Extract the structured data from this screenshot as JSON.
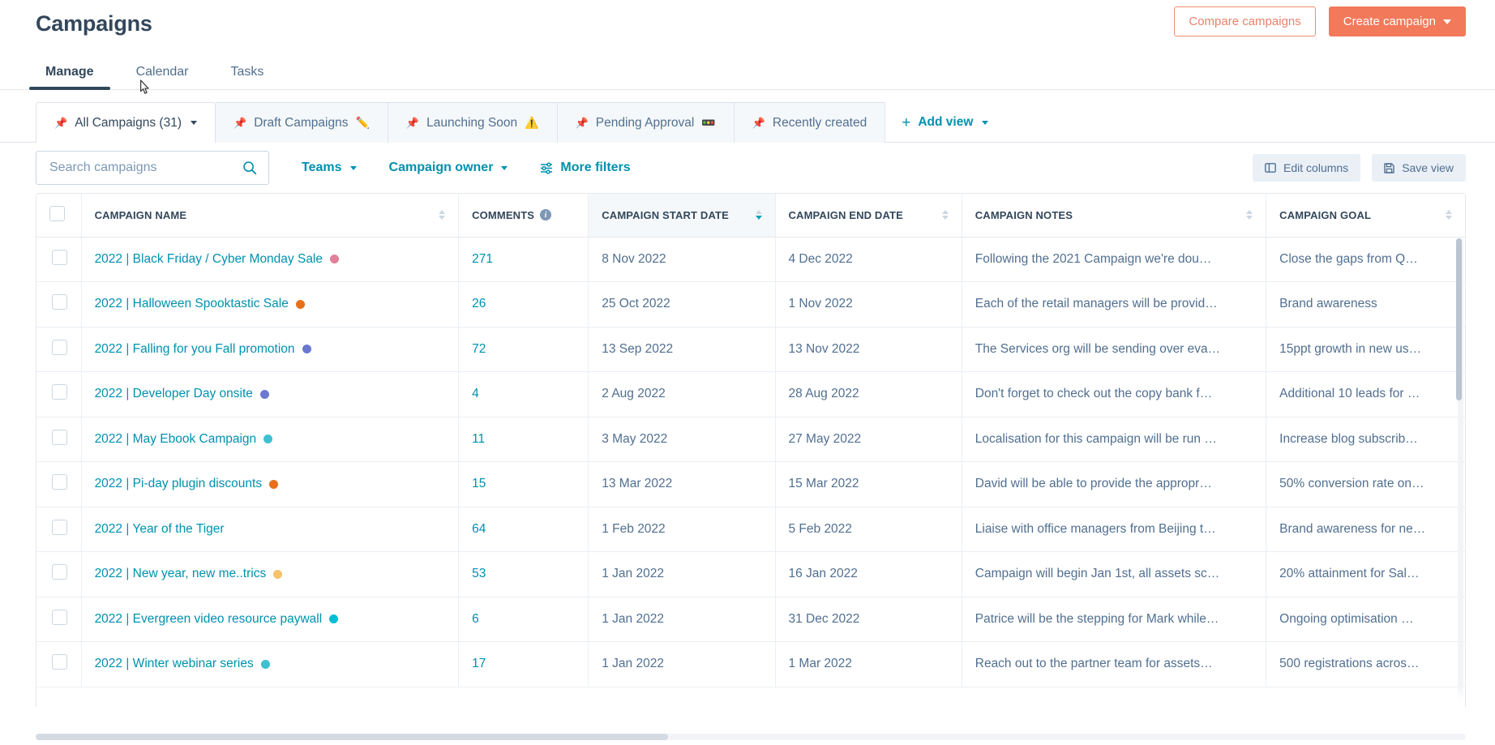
{
  "header": {
    "title": "Campaigns",
    "compare_label": "Compare campaigns",
    "create_label": "Create campaign"
  },
  "top_tabs": [
    {
      "label": "Manage",
      "active": true
    },
    {
      "label": "Calendar",
      "active": false
    },
    {
      "label": "Tasks",
      "active": false
    }
  ],
  "view_tabs": [
    {
      "label": "All Campaigns (31)",
      "emoji": "",
      "active": true,
      "has_caret": true
    },
    {
      "label": "Draft Campaigns",
      "emoji": "✏️",
      "active": false,
      "has_caret": false
    },
    {
      "label": "Launching Soon",
      "emoji": "⚠️",
      "active": false,
      "has_caret": false
    },
    {
      "label": "Pending Approval",
      "emoji": "🚥",
      "active": false,
      "has_caret": false
    },
    {
      "label": "Recently created",
      "emoji": "",
      "active": false,
      "has_caret": false
    }
  ],
  "add_view": {
    "label": "Add view"
  },
  "filters": {
    "search_placeholder": "Search campaigns",
    "search_value": "",
    "search_icon": "search-icon",
    "teams_label": "Teams",
    "owner_label": "Campaign owner",
    "more_filters_label": "More filters",
    "edit_columns_label": "Edit columns",
    "save_view_label": "Save view"
  },
  "table": {
    "columns": [
      {
        "label": "CAMPAIGN NAME",
        "sortable": true,
        "sorted": false,
        "info": false
      },
      {
        "label": "COMMENTS",
        "sortable": false,
        "sorted": false,
        "info": true
      },
      {
        "label": "CAMPAIGN START DATE",
        "sortable": true,
        "sorted": true,
        "info": false
      },
      {
        "label": "CAMPAIGN END DATE",
        "sortable": true,
        "sorted": false,
        "info": false
      },
      {
        "label": "CAMPAIGN NOTES",
        "sortable": true,
        "sorted": false,
        "info": false
      },
      {
        "label": "CAMPAIGN GOAL",
        "sortable": true,
        "sorted": false,
        "info": false
      }
    ],
    "rows": [
      {
        "name": "2022 | Black Friday / Cyber Monday Sale",
        "dot": "#e08099",
        "comments": "271",
        "start": "8 Nov 2022",
        "end": "4 Dec 2022",
        "notes": "Following the 2021 Campaign we're dou…",
        "goal": "Close the gaps from Q…"
      },
      {
        "name": "2022 | Halloween Spooktastic Sale",
        "dot": "#e8701a",
        "comments": "26",
        "start": "25 Oct 2022",
        "end": "1 Nov 2022",
        "notes": "Each of the retail managers will be provid…",
        "goal": "Brand awareness"
      },
      {
        "name": "2022 | Falling for you Fall promotion",
        "dot": "#6a78d1",
        "comments": "72",
        "start": "13 Sep 2022",
        "end": "13 Nov 2022",
        "notes": "The Services org will be sending over eva…",
        "goal": "15ppt growth in new us…"
      },
      {
        "name": "2022 | Developer Day onsite",
        "dot": "#6a78d1",
        "comments": "4",
        "start": "2 Aug 2022",
        "end": "28 Aug 2022",
        "notes": "Don't forget to check out the copy bank f…",
        "goal": "Additional 10 leads for …"
      },
      {
        "name": "2022 | May Ebook Campaign",
        "dot": "#3fc0d0",
        "comments": "11",
        "start": "3 May 2022",
        "end": "27 May 2022",
        "notes": "Localisation for this campaign will be run …",
        "goal": "Increase blog subscrib…"
      },
      {
        "name": "2022 | Pi-day plugin discounts",
        "dot": "#e8701a",
        "comments": "15",
        "start": "13 Mar 2022",
        "end": "15 Mar 2022",
        "notes": "David will be able to provide the appropr…",
        "goal": "50% conversion rate on…"
      },
      {
        "name": "2022 | Year of the Tiger",
        "dot": "",
        "comments": "64",
        "start": "1 Feb 2022",
        "end": "5 Feb 2022",
        "notes": "Liaise with office managers from Beijing t…",
        "goal": "Brand awareness for ne…"
      },
      {
        "name": "2022 | New year, new me..trics",
        "dot": "#f5c26b",
        "comments": "53",
        "start": "1 Jan 2022",
        "end": "16 Jan 2022",
        "notes": "Campaign will begin Jan 1st, all assets sc…",
        "goal": "20% attainment for Sal…"
      },
      {
        "name": "2022 | Evergreen video resource paywall",
        "dot": "#00bdd6",
        "comments": "6",
        "start": "1 Jan 2022",
        "end": "31 Dec 2022",
        "notes": "Patrice will be the stepping for Mark while…",
        "goal": "Ongoing optimisation …"
      },
      {
        "name": "2022 | Winter webinar series",
        "dot": "#3fc0d0",
        "comments": "17",
        "start": "1 Jan 2022",
        "end": "1 Mar 2022",
        "notes": "Reach out to the partner team for assets…",
        "goal": "500 registrations acros…"
      }
    ]
  },
  "colors": {
    "accent_teal": "#0091ae",
    "brand_orange": "#f2795a",
    "text_primary": "#33475b"
  }
}
